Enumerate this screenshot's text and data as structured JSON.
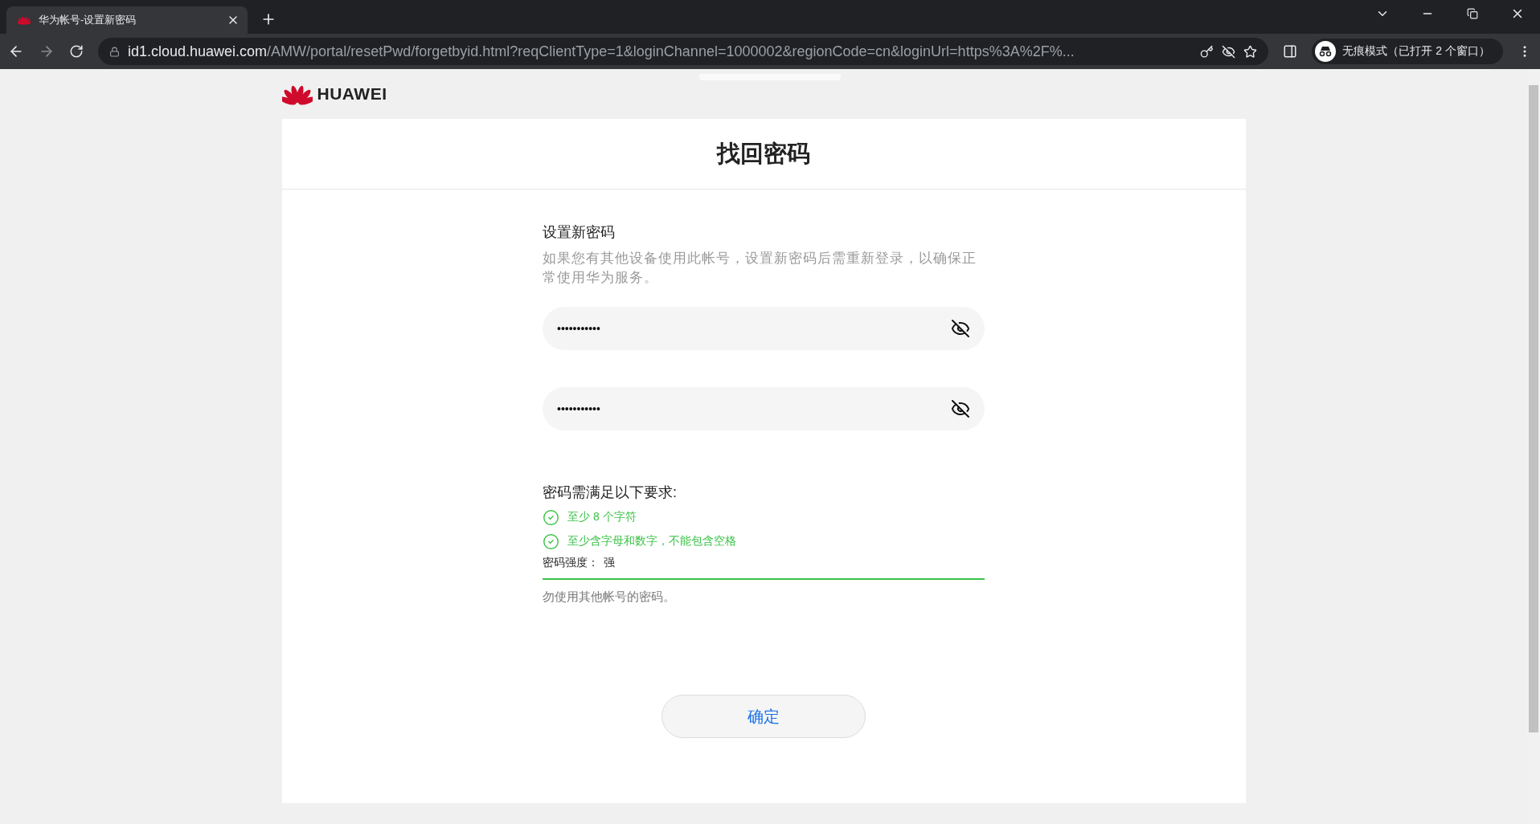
{
  "browser": {
    "tab": {
      "title": "华为帐号-设置新密码",
      "selected": true
    },
    "address": {
      "host": "id1.cloud.huawei.com",
      "path": "/AMW/portal/resetPwd/forgetbyid.html?reqClientType=1&loginChannel=1000002&regionCode=cn&loginUrl=https%3A%2F%..."
    },
    "profile": "无痕模式（已打开 2 个窗口）"
  },
  "page": {
    "logo": "HUAWEI",
    "title": "找回密码",
    "section_title": "设置新密码",
    "description": "如果您有其他设备使用此帐号，设置新密码后需重新登录，以确保正常使用华为服务。",
    "password_fields": [
      {
        "value": "•••••••••••"
      },
      {
        "value": "•••••••••••"
      }
    ],
    "requirements": {
      "heading": "密码需满足以下要求:",
      "items": [
        {
          "text": "至少 8 个字符",
          "met": true
        },
        {
          "text": "至少含字母和数字，不能包含空格",
          "met": true
        }
      ]
    },
    "strength": {
      "label": "密码强度：",
      "value": "强",
      "level": 1
    },
    "note": "勿使用其他帐号的密码。",
    "confirm_button": "确定"
  }
}
